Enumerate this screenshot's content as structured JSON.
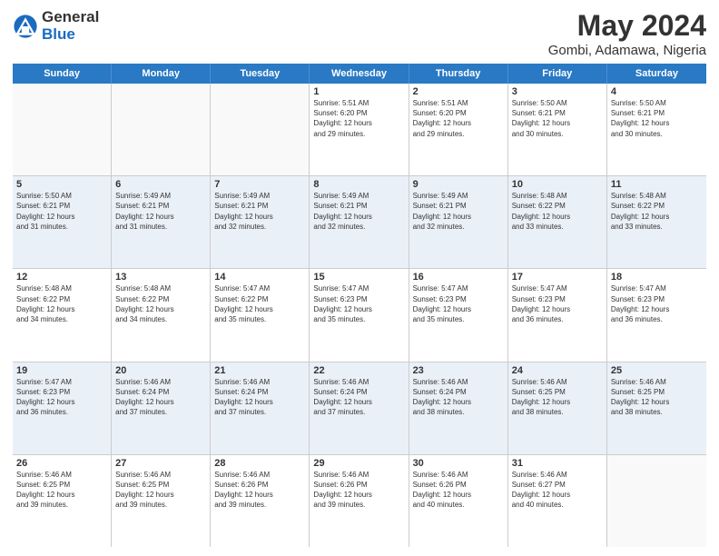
{
  "logo": {
    "general": "General",
    "blue": "Blue"
  },
  "title": "May 2024",
  "subtitle": "Gombi, Adamawa, Nigeria",
  "days_of_week": [
    "Sunday",
    "Monday",
    "Tuesday",
    "Wednesday",
    "Thursday",
    "Friday",
    "Saturday"
  ],
  "weeks": [
    [
      {
        "day": "",
        "info": ""
      },
      {
        "day": "",
        "info": ""
      },
      {
        "day": "",
        "info": ""
      },
      {
        "day": "1",
        "info": "Sunrise: 5:51 AM\nSunset: 6:20 PM\nDaylight: 12 hours\nand 29 minutes."
      },
      {
        "day": "2",
        "info": "Sunrise: 5:51 AM\nSunset: 6:20 PM\nDaylight: 12 hours\nand 29 minutes."
      },
      {
        "day": "3",
        "info": "Sunrise: 5:50 AM\nSunset: 6:21 PM\nDaylight: 12 hours\nand 30 minutes."
      },
      {
        "day": "4",
        "info": "Sunrise: 5:50 AM\nSunset: 6:21 PM\nDaylight: 12 hours\nand 30 minutes."
      }
    ],
    [
      {
        "day": "5",
        "info": "Sunrise: 5:50 AM\nSunset: 6:21 PM\nDaylight: 12 hours\nand 31 minutes."
      },
      {
        "day": "6",
        "info": "Sunrise: 5:49 AM\nSunset: 6:21 PM\nDaylight: 12 hours\nand 31 minutes."
      },
      {
        "day": "7",
        "info": "Sunrise: 5:49 AM\nSunset: 6:21 PM\nDaylight: 12 hours\nand 32 minutes."
      },
      {
        "day": "8",
        "info": "Sunrise: 5:49 AM\nSunset: 6:21 PM\nDaylight: 12 hours\nand 32 minutes."
      },
      {
        "day": "9",
        "info": "Sunrise: 5:49 AM\nSunset: 6:21 PM\nDaylight: 12 hours\nand 32 minutes."
      },
      {
        "day": "10",
        "info": "Sunrise: 5:48 AM\nSunset: 6:22 PM\nDaylight: 12 hours\nand 33 minutes."
      },
      {
        "day": "11",
        "info": "Sunrise: 5:48 AM\nSunset: 6:22 PM\nDaylight: 12 hours\nand 33 minutes."
      }
    ],
    [
      {
        "day": "12",
        "info": "Sunrise: 5:48 AM\nSunset: 6:22 PM\nDaylight: 12 hours\nand 34 minutes."
      },
      {
        "day": "13",
        "info": "Sunrise: 5:48 AM\nSunset: 6:22 PM\nDaylight: 12 hours\nand 34 minutes."
      },
      {
        "day": "14",
        "info": "Sunrise: 5:47 AM\nSunset: 6:22 PM\nDaylight: 12 hours\nand 35 minutes."
      },
      {
        "day": "15",
        "info": "Sunrise: 5:47 AM\nSunset: 6:23 PM\nDaylight: 12 hours\nand 35 minutes."
      },
      {
        "day": "16",
        "info": "Sunrise: 5:47 AM\nSunset: 6:23 PM\nDaylight: 12 hours\nand 35 minutes."
      },
      {
        "day": "17",
        "info": "Sunrise: 5:47 AM\nSunset: 6:23 PM\nDaylight: 12 hours\nand 36 minutes."
      },
      {
        "day": "18",
        "info": "Sunrise: 5:47 AM\nSunset: 6:23 PM\nDaylight: 12 hours\nand 36 minutes."
      }
    ],
    [
      {
        "day": "19",
        "info": "Sunrise: 5:47 AM\nSunset: 6:23 PM\nDaylight: 12 hours\nand 36 minutes."
      },
      {
        "day": "20",
        "info": "Sunrise: 5:46 AM\nSunset: 6:24 PM\nDaylight: 12 hours\nand 37 minutes."
      },
      {
        "day": "21",
        "info": "Sunrise: 5:46 AM\nSunset: 6:24 PM\nDaylight: 12 hours\nand 37 minutes."
      },
      {
        "day": "22",
        "info": "Sunrise: 5:46 AM\nSunset: 6:24 PM\nDaylight: 12 hours\nand 37 minutes."
      },
      {
        "day": "23",
        "info": "Sunrise: 5:46 AM\nSunset: 6:24 PM\nDaylight: 12 hours\nand 38 minutes."
      },
      {
        "day": "24",
        "info": "Sunrise: 5:46 AM\nSunset: 6:25 PM\nDaylight: 12 hours\nand 38 minutes."
      },
      {
        "day": "25",
        "info": "Sunrise: 5:46 AM\nSunset: 6:25 PM\nDaylight: 12 hours\nand 38 minutes."
      }
    ],
    [
      {
        "day": "26",
        "info": "Sunrise: 5:46 AM\nSunset: 6:25 PM\nDaylight: 12 hours\nand 39 minutes."
      },
      {
        "day": "27",
        "info": "Sunrise: 5:46 AM\nSunset: 6:25 PM\nDaylight: 12 hours\nand 39 minutes."
      },
      {
        "day": "28",
        "info": "Sunrise: 5:46 AM\nSunset: 6:26 PM\nDaylight: 12 hours\nand 39 minutes."
      },
      {
        "day": "29",
        "info": "Sunrise: 5:46 AM\nSunset: 6:26 PM\nDaylight: 12 hours\nand 39 minutes."
      },
      {
        "day": "30",
        "info": "Sunrise: 5:46 AM\nSunset: 6:26 PM\nDaylight: 12 hours\nand 40 minutes."
      },
      {
        "day": "31",
        "info": "Sunrise: 5:46 AM\nSunset: 6:27 PM\nDaylight: 12 hours\nand 40 minutes."
      },
      {
        "day": "",
        "info": ""
      }
    ]
  ]
}
